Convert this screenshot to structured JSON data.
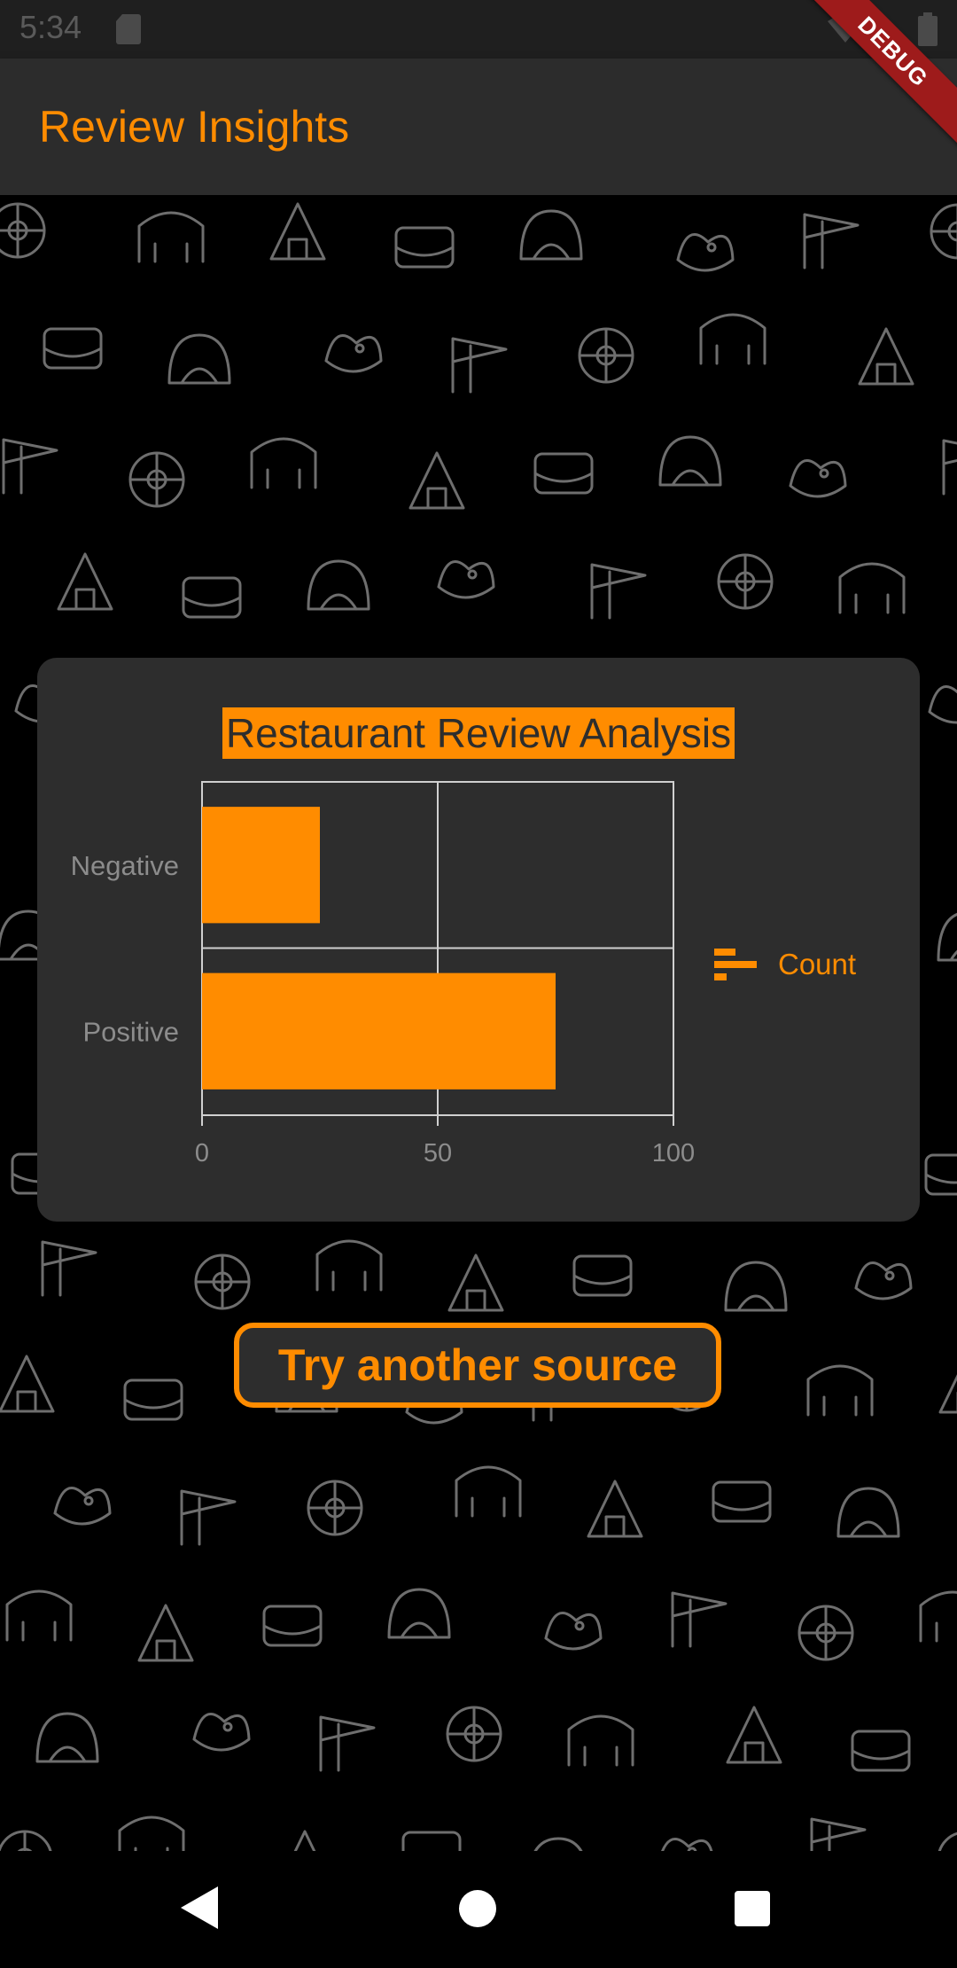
{
  "status_bar": {
    "time": "5:34",
    "icons": [
      "sd-card-icon",
      "wifi-icon",
      "battery-icon"
    ]
  },
  "debug_banner": {
    "label": "DEBUG"
  },
  "app_bar": {
    "title": "Review Insights"
  },
  "chart_card": {
    "chart_data": {
      "type": "bar",
      "orientation": "horizontal",
      "title": "Restaurant Review Analysis",
      "categories": [
        "Negative",
        "Positive"
      ],
      "series": [
        {
          "name": "Count",
          "values": [
            25,
            75
          ],
          "color": "#ff8c00"
        }
      ],
      "xlim": [
        0,
        100
      ],
      "x_ticks": [
        "0",
        "50",
        "100"
      ],
      "grid": true,
      "legend": {
        "placement": "right",
        "entries": [
          "Count"
        ]
      }
    }
  },
  "actions": {
    "try_another_label": "Try another source"
  },
  "nav_bar": {
    "icons": [
      "back-icon",
      "home-icon",
      "recents-icon"
    ]
  },
  "colors": {
    "accent": "#ff8c00",
    "app_bar": "#2c2c2c",
    "card": "#2d2d2d",
    "background": "#000000",
    "debug": "#9e1b1b"
  }
}
